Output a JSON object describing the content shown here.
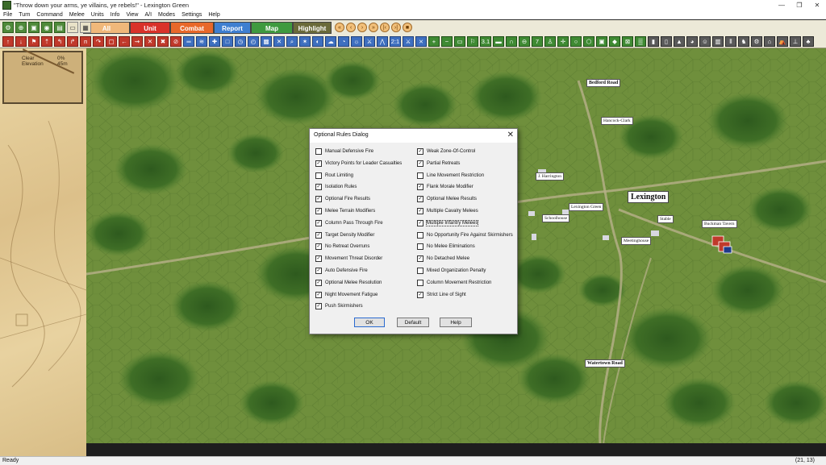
{
  "window": {
    "title": "\"Throw down your arms, ye villains, ye rebels!\" - Lexington Green",
    "minimize": "—",
    "maximize": "❐",
    "close": "✕"
  },
  "menu": [
    "File",
    "Turn",
    "Command",
    "Melee",
    "Units",
    "Info",
    "View",
    "A/I",
    "Modes",
    "Settings",
    "Help"
  ],
  "mode_tabs": {
    "all": "All",
    "unit": "Unit",
    "combat": "Combat",
    "report": "Report",
    "map": "Map",
    "highlight": "Highlight"
  },
  "left_panel": {
    "terrain": "Clear",
    "terrain_value": "0%",
    "elevation_label": "Elevation",
    "elevation_value": "45m"
  },
  "map_labels": {
    "bedford_road": "Bedford Road",
    "hancock_clark": "Hancock-Clark",
    "harrington": "J. Harrington",
    "lexington_green": "Lexington Green",
    "lexington": "Lexington",
    "stable": "Stable",
    "buckman_tavern": "Buckman Tavern",
    "schoolhouse": "Schoolhouse",
    "meetinghouse": "Meetinghouse",
    "watertown_road": "Watertown Road"
  },
  "dialog": {
    "title": "Optional Rules Dialog",
    "close": "✕",
    "left_options": [
      {
        "label": "Manual Defensive Fire",
        "checked": false
      },
      {
        "label": "Victory Points for Leader Casualties",
        "checked": true
      },
      {
        "label": "Rout Limiting",
        "checked": false
      },
      {
        "label": "Isolation Rules",
        "checked": true
      },
      {
        "label": "Optional Fire Results",
        "checked": true
      },
      {
        "label": "Melee Terrain Modifiers",
        "checked": true
      },
      {
        "label": "Column Pass Through Fire",
        "checked": true
      },
      {
        "label": "Target Density Modifier",
        "checked": true
      },
      {
        "label": "No Retreat Overruns",
        "checked": true
      },
      {
        "label": "Movement Threat Disorder",
        "checked": true
      },
      {
        "label": "Auto Defensive Fire",
        "checked": true
      },
      {
        "label": "Optional Melee Resolution",
        "checked": true
      },
      {
        "label": "Night Movement Fatigue",
        "checked": true
      },
      {
        "label": "Push Skirmishers",
        "checked": true
      }
    ],
    "right_options": [
      {
        "label": "Weak Zone-Of-Control",
        "checked": true
      },
      {
        "label": "Partial Retreats",
        "checked": true
      },
      {
        "label": "Line Movement Restriction",
        "checked": false
      },
      {
        "label": "Flank Morale Modifier",
        "checked": true
      },
      {
        "label": "Optional Melee Results",
        "checked": true
      },
      {
        "label": "Multiple Cavalry Melees",
        "checked": true
      },
      {
        "label": "Multiple Infantry Melees",
        "checked": true
      },
      {
        "label": "No Opportunity Fire Against Skirmishers",
        "checked": false
      },
      {
        "label": "No Melee Eliminations",
        "checked": false
      },
      {
        "label": "No Detached Melee",
        "checked": true
      },
      {
        "label": "Mixed Organization Penalty",
        "checked": false
      },
      {
        "label": "Column Movement Restriction",
        "checked": false
      },
      {
        "label": "Strict Line of Sight",
        "checked": true
      }
    ],
    "buttons": {
      "ok": "OK",
      "default": "Default",
      "help": "Help"
    }
  },
  "status": {
    "text": "Ready",
    "coords": "(21, 13)"
  },
  "toolbar2_icons": [
    "2:1",
    "3.1",
    "7"
  ]
}
